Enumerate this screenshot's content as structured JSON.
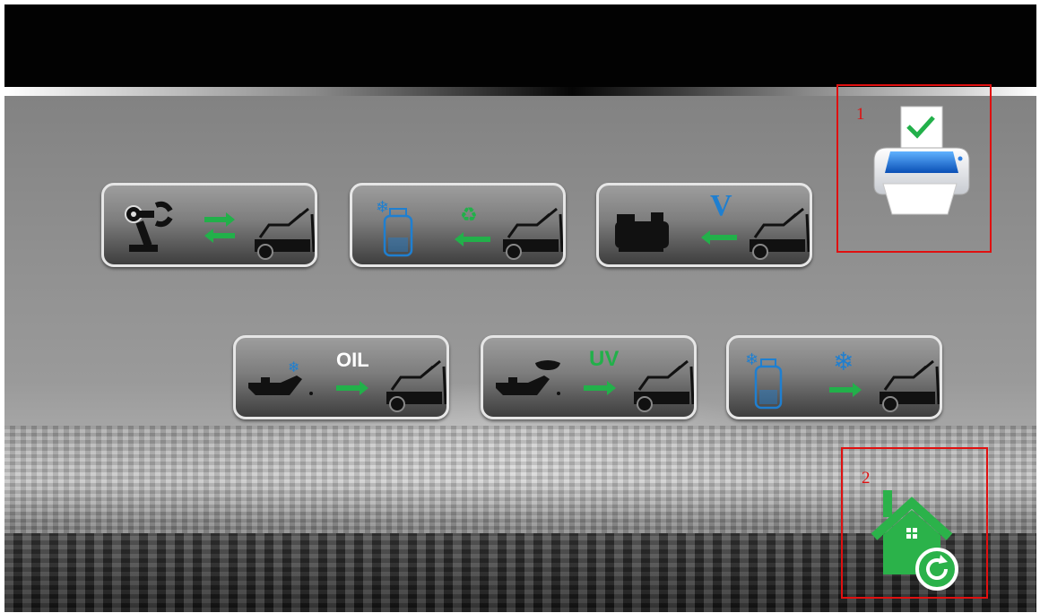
{
  "functions": [
    {
      "id": "recover-recycle-charge",
      "icon": "robot-arm-transfer-car-icon"
    },
    {
      "id": "recovery",
      "icon": "refrigerant-tank-recycle-car-icon"
    },
    {
      "id": "vacuum",
      "icon": "vacuum-pump-car-icon",
      "label": "V"
    },
    {
      "id": "oil-inject",
      "icon": "oil-can-car-icon",
      "label": "OIL"
    },
    {
      "id": "uv-inject",
      "icon": "dye-can-car-icon",
      "label": "UV"
    },
    {
      "id": "charge",
      "icon": "tank-snowflake-car-icon"
    }
  ],
  "annotations": [
    {
      "number": "1",
      "target": "print-icon"
    },
    {
      "number": "2",
      "target": "home-icon"
    }
  ],
  "colors": {
    "accent_green": "#22b04a",
    "accent_blue": "#1f7fd0",
    "highlight_red": "#e01010"
  }
}
